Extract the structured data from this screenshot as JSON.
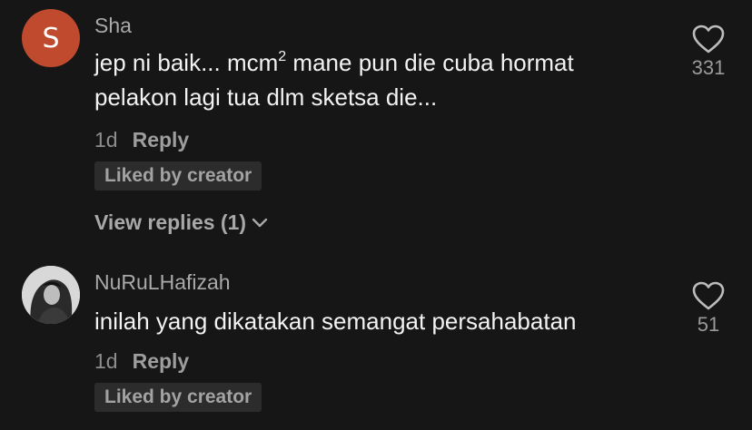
{
  "comments": [
    {
      "avatar_letter": "S",
      "avatar_color": "#bf4a2d",
      "username": "Sha",
      "text_part1": "jep ni baik... mcm",
      "text_sup": "2",
      "text_part2": " mane pun die cuba hormat pelakon lagi tua dlm sketsa die...",
      "time": "1d",
      "reply_label": "Reply",
      "liked_badge": "Liked by creator",
      "view_replies_label": "View replies (1)",
      "like_icon": "heart-outline-icon",
      "like_count": "331"
    },
    {
      "avatar_icon": "profile-photo",
      "username": "NuRuLHafizah",
      "text": "inilah yang dikatakan semangat persahabatan",
      "time": "1d",
      "reply_label": "Reply",
      "liked_badge": "Liked by creator",
      "like_icon": "heart-outline-icon",
      "like_count": "51"
    }
  ]
}
